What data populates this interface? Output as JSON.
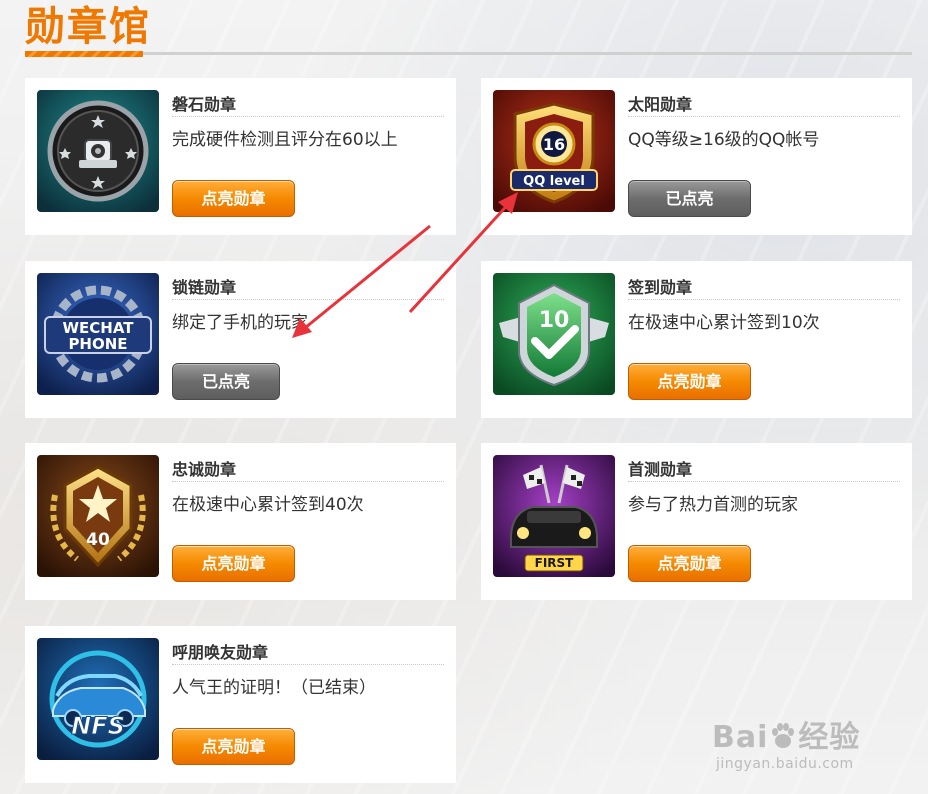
{
  "page": {
    "title": "勋章馆"
  },
  "colors": {
    "accent": "#f07800",
    "button_active": "#f58a00",
    "button_done": "#6d6d6d",
    "arrow": "#e8333a"
  },
  "badges": [
    {
      "name": "磐石勋章",
      "desc": "完成硬件检测且评分在60以上",
      "button": "点亮勋章",
      "state": "unlit",
      "icon": "rock-badge-icon"
    },
    {
      "name": "太阳勋章",
      "desc": "QQ等级≥16级的QQ帐号",
      "button": "已点亮",
      "state": "lit",
      "icon": "sun-badge-icon",
      "icon_text": [
        "16",
        "QQ level"
      ]
    },
    {
      "name": "锁链勋章",
      "desc": "绑定了手机的玩家",
      "button": "已点亮",
      "state": "lit",
      "icon": "chain-badge-icon",
      "icon_text": [
        "WECHAT",
        "PHONE"
      ]
    },
    {
      "name": "签到勋章",
      "desc": "在极速中心累计签到10次",
      "button": "点亮勋章",
      "state": "unlit",
      "icon": "checkin-badge-icon",
      "icon_text": [
        "10"
      ]
    },
    {
      "name": "忠诚勋章",
      "desc": "在极速中心累计签到40次",
      "button": "点亮勋章",
      "state": "unlit",
      "icon": "loyalty-badge-icon",
      "icon_text": [
        "40"
      ]
    },
    {
      "name": "首测勋章",
      "desc": "参与了热力首测的玩家",
      "button": "点亮勋章",
      "state": "unlit",
      "icon": "first-test-badge-icon",
      "icon_text": [
        "FIRST"
      ]
    },
    {
      "name": "呼朋唤友勋章",
      "desc": "人气王的证明！（已结束）",
      "button": "点亮勋章",
      "state": "unlit",
      "icon": "friends-badge-icon",
      "icon_text": [
        "NFS"
      ]
    }
  ],
  "watermark": {
    "main": "Bai",
    "main2": "经验",
    "sub": "jingyan.baidu.com"
  }
}
